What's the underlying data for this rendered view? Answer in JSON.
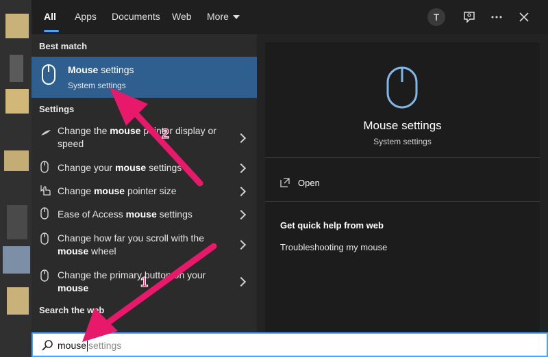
{
  "tabs": [
    {
      "label": "All",
      "active": true
    },
    {
      "label": "Apps"
    },
    {
      "label": "Documents"
    },
    {
      "label": "Web"
    },
    {
      "label": "More"
    }
  ],
  "avatar_letter": "T",
  "icons": {
    "feedback": "feedback-icon",
    "more": "ellipsis-icon",
    "close": "close-icon"
  },
  "best_match": {
    "section": "Best match",
    "title_bold": "Mouse",
    "title_rest": " settings",
    "subtitle": "System settings"
  },
  "settings_section": "Settings",
  "settings_items": [
    {
      "pre": "Change the ",
      "bold": "mouse",
      "post": " pointer display or speed",
      "icon": "pointer-speed-icon"
    },
    {
      "pre": "Change your ",
      "bold": "mouse",
      "post": " settings",
      "icon": "mouse-icon"
    },
    {
      "pre": "Change ",
      "bold": "mouse",
      "post": " pointer size",
      "icon": "pointer-hand-icon"
    },
    {
      "pre": "Ease of Access ",
      "bold": "mouse",
      "post": " settings",
      "icon": "mouse-icon"
    },
    {
      "pre": "Change how far you scroll with the ",
      "bold": "mouse",
      "post": " wheel",
      "icon": "mouse-icon"
    },
    {
      "pre": "Change the primary button on your ",
      "bold": "mouse",
      "post": "",
      "icon": "mouse-icon"
    }
  ],
  "web_section": "Search the web",
  "preview": {
    "title": "Mouse settings",
    "subtitle": "System settings",
    "open_label": "Open",
    "help_title": "Get quick help from web",
    "help_link": "Troubleshooting my mouse"
  },
  "search": {
    "typed": "mouse",
    "hint": "settings"
  },
  "annotations": {
    "label1": "1",
    "label2": "2",
    "color": "#e8196a"
  },
  "colors": {
    "accent": "#4aa3ff",
    "selected": "#2f5f8f"
  }
}
